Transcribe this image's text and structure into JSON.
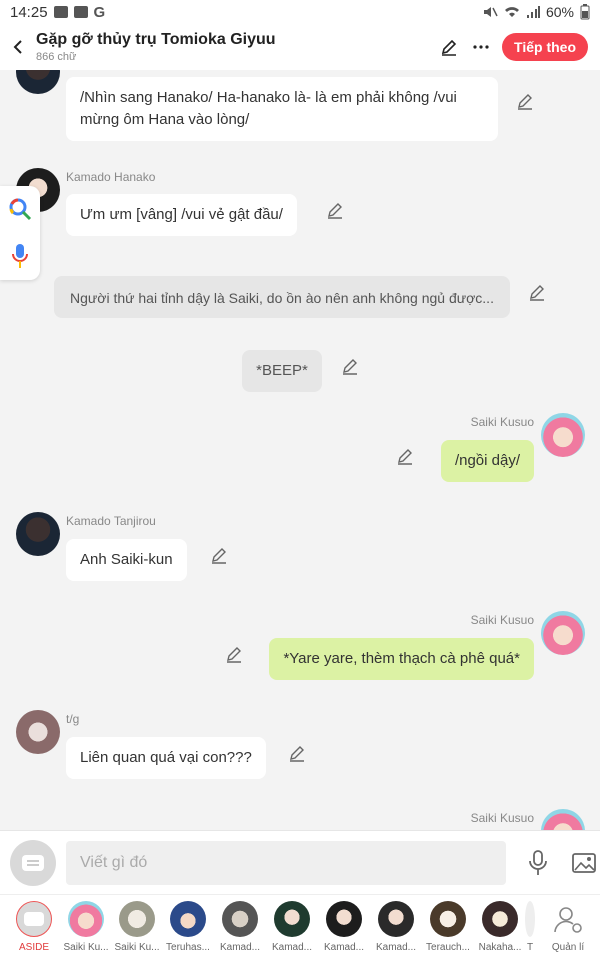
{
  "status_bar": {
    "time": "14:25",
    "battery": "60%",
    "google_letter": "G"
  },
  "header": {
    "title": "Gặp gỡ thủy trụ Tomioka Giyuu",
    "subtitle": "866 chữ",
    "next_button": "Tiếp theo"
  },
  "messages": [
    {
      "sender": "",
      "text_line1": "/Nhìn sang Hanako/ Ha-hanako là- là em phải không /vui",
      "text_line2": "mừng ôm Hana vào lòng/"
    },
    {
      "sender": "Kamado Hanako",
      "text": "Ưm ưm [vâng] /vui vẻ gật đầu/"
    },
    {
      "sender": "",
      "text": "Người thứ hai tỉnh dậy là Saiki, do ồn ào nên anh không ngủ được..."
    },
    {
      "sender": "",
      "text": "*BEEP*"
    },
    {
      "sender": "Saiki Kusuo",
      "text": "/ngồi dậy/"
    },
    {
      "sender": "Kamado Tanjirou",
      "text": "Anh Saiki-kun"
    },
    {
      "sender": "Saiki Kusuo",
      "text": "*Yare yare, thèm thạch cà phê quá*"
    },
    {
      "sender": "t/g",
      "text": "Liên quan quá vại con???"
    },
    {
      "sender": "Saiki Kusuo",
      "text": ""
    }
  ],
  "input": {
    "placeholder": "Viết gì đó"
  },
  "characters": [
    {
      "name": "ASIDE"
    },
    {
      "name": "Saiki Ku..."
    },
    {
      "name": "Saiki Ku..."
    },
    {
      "name": "Teruhas..."
    },
    {
      "name": "Kamad..."
    },
    {
      "name": "Kamad..."
    },
    {
      "name": "Kamad..."
    },
    {
      "name": "Kamad..."
    },
    {
      "name": "Terauch..."
    },
    {
      "name": "Nakaha..."
    },
    {
      "name": "T"
    },
    {
      "name": "Quản lí"
    }
  ],
  "colors": {
    "accent": "#f5424f",
    "bubble_green": "#dcf2a4",
    "bubble_white": "#ffffff",
    "bubble_gray": "#e6e6e6",
    "background": "#f3f3f3"
  },
  "icons": [
    "back-arrow-icon",
    "pen-icon",
    "more-icon",
    "edit-icon",
    "google-search-icon",
    "microphone-icon",
    "chat-bubble-icon",
    "image-icon",
    "manage-user-icon"
  ]
}
